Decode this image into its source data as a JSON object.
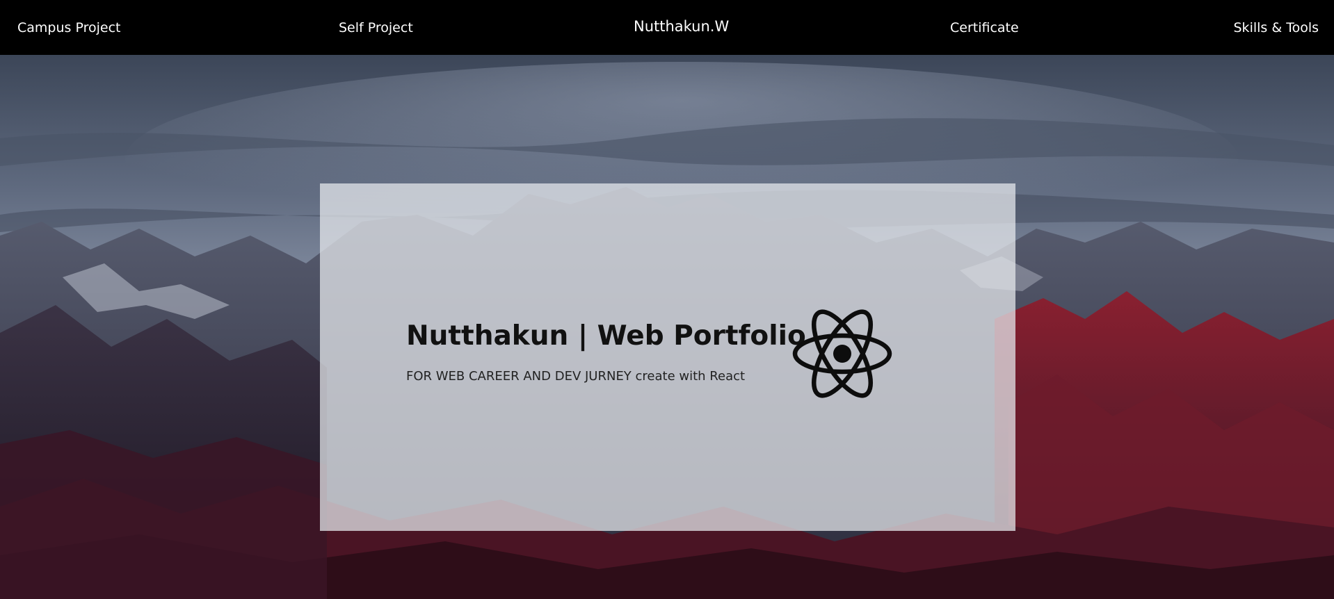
{
  "nav": {
    "campus_project": "Campus Project",
    "self_project": "Self Project",
    "brand": "Nutthakun.W",
    "certificate": "Certificate",
    "skills_tools": "Skills & Tools"
  },
  "hero": {
    "title": "Nutthakun | Web Portfolio",
    "subtitle": "FOR WEB CAREER AND DEV JURNEY create with React",
    "logo_icon": "react-atom-icon"
  },
  "colors": {
    "nav_background": "#000000",
    "nav_text": "#ffffff",
    "card_background": "#e6e8ec",
    "text_dark": "#111111"
  }
}
